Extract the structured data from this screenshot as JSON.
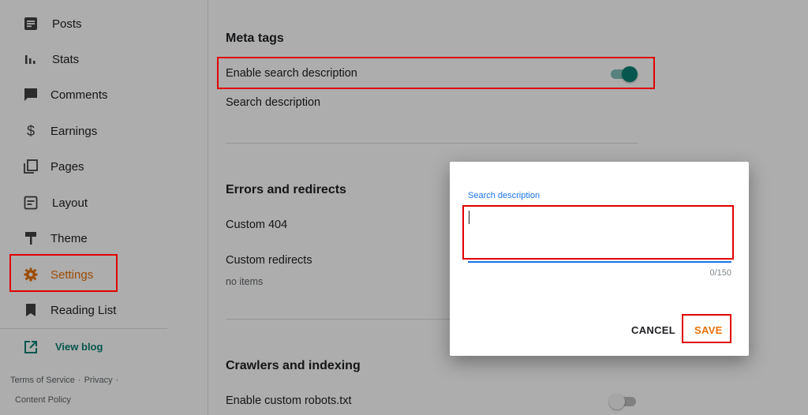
{
  "sidebar": {
    "items": [
      {
        "label": "Posts",
        "icon": "posts-icon"
      },
      {
        "label": "Stats",
        "icon": "stats-icon"
      },
      {
        "label": "Comments",
        "icon": "comments-icon"
      },
      {
        "label": "Earnings",
        "icon": "dollar-icon"
      },
      {
        "label": "Pages",
        "icon": "pages-icon"
      },
      {
        "label": "Layout",
        "icon": "layout-icon"
      },
      {
        "label": "Theme",
        "icon": "paint-roller-icon"
      },
      {
        "label": "Settings",
        "icon": "gear-icon"
      },
      {
        "label": "Reading List",
        "icon": "bookmark-icon"
      }
    ],
    "view_blog": "View blog",
    "footer": {
      "terms": "Terms of Service",
      "privacy": "Privacy",
      "content_policy": "Content Policy",
      "separator": "·"
    }
  },
  "main": {
    "meta_tags": {
      "title": "Meta tags",
      "enable_search_description": "Enable search description",
      "search_description": "Search description"
    },
    "errors": {
      "title": "Errors and redirects",
      "custom_404": "Custom 404",
      "custom_redirects": "Custom redirects",
      "no_items": "no items"
    },
    "crawlers": {
      "title": "Crawlers and indexing",
      "enable_robots": "Enable custom robots.txt"
    }
  },
  "dialog": {
    "field_label": "Search description",
    "value": "",
    "counter": "0/150",
    "cancel": "CANCEL",
    "save": "SAVE"
  },
  "colors": {
    "accent_orange": "#e8710a",
    "accent_teal": "#0b8074",
    "focus_blue": "#1a73e8",
    "highlight_red": "#e00000"
  }
}
